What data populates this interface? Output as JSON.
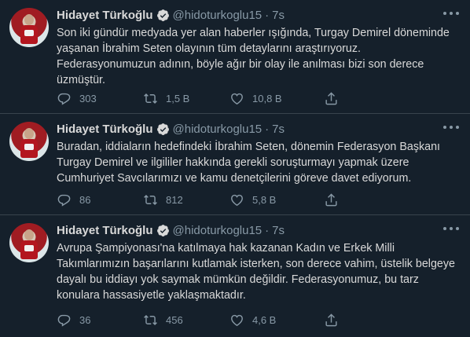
{
  "tweets": [
    {
      "name": "Hidayet Türkoğlu",
      "handle": "@hidoturkoglu15",
      "dot": "·",
      "time": "7s",
      "text": "Son iki gündür medyada yer alan haberler ışığında, Turgay Demirel döneminde yaşanan İbrahim Seten olayının tüm detaylarını araştırıyoruz. Federasyonumuzun adının, böyle ağır bir olay ile anılması bizi son derece üzmüştür.",
      "replies": "303",
      "retweets": "1,5 B",
      "likes": "10,8 B"
    },
    {
      "name": "Hidayet Türkoğlu",
      "handle": "@hidoturkoglu15",
      "dot": "·",
      "time": "7s",
      "text": "Buradan, iddiaların hedefindeki İbrahim Seten, dönemin Federasyon Başkanı Turgay Demirel ve ilgililer hakkında gerekli soruşturmayı yapmak üzere Cumhuriyet Savcılarımızı ve kamu denetçilerini göreve davet ediyorum.",
      "replies": "86",
      "retweets": "812",
      "likes": "5,8 B"
    },
    {
      "name": "Hidayet Türkoğlu",
      "handle": "@hidoturkoglu15",
      "dot": "·",
      "time": "7s",
      "text": "Avrupa Şampiyonası'na katılmaya hak kazanan Kadın ve Erkek Milli Takımlarımızın başarılarını kutlamak isterken, son derece vahim, üstelik belgeye dayalı bu iddiayı yok saymak mümkün değildir. Federasyonumuz, bu tarz konulara hassasiyetle yaklaşmaktadır.",
      "replies": "36",
      "retweets": "456",
      "likes": "4,6 B"
    }
  ],
  "colors": {
    "background": "#15202b",
    "text": "#d9d9d9",
    "muted": "#8899a6",
    "verified": "#d9d9d9",
    "divider": "#38444d"
  },
  "icons": [
    "verified-badge-icon",
    "more-options-icon",
    "reply-icon",
    "retweet-icon",
    "like-icon",
    "share-icon"
  ]
}
